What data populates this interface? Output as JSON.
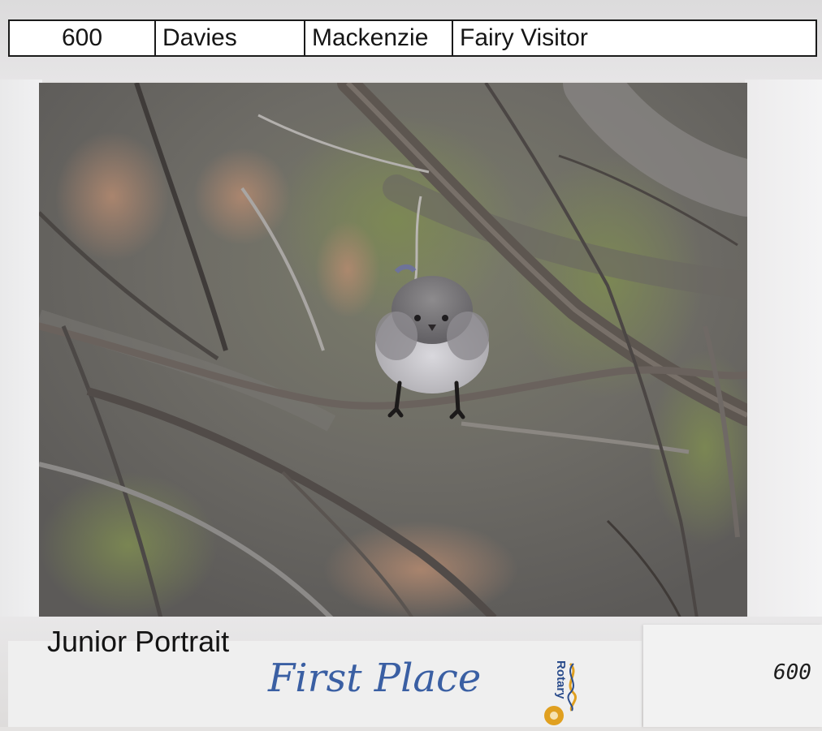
{
  "entry_label": {
    "number": "600",
    "surname": "Davies",
    "first_name": "Mackenzie",
    "title": "Fairy Visitor"
  },
  "category": "Junior Portrait",
  "award": "First Place",
  "logo_text": "Rotary",
  "tag_number": "600",
  "colors": {
    "award_blue": "#3a5fa3",
    "logo_gold": "#e0a020",
    "logo_blue": "#2a4c8c"
  }
}
